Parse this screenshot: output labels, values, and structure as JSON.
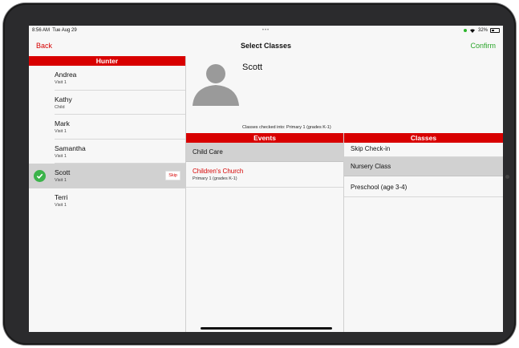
{
  "status": {
    "time": "8:56 AM",
    "date": "Tue Aug 29",
    "battery": "32%"
  },
  "nav": {
    "back": "Back",
    "title": "Select Classes",
    "confirm": "Confirm"
  },
  "family": {
    "header": "Hunter",
    "members": [
      {
        "name": "Andrea",
        "sub": "Visit 1"
      },
      {
        "name": "Kathy",
        "sub": "Child"
      },
      {
        "name": "Mark",
        "sub": "Visit 1"
      },
      {
        "name": "Samantha",
        "sub": "Visit 1"
      },
      {
        "name": "Scott",
        "sub": "Visit 1",
        "skip": "Skip"
      },
      {
        "name": "Terri",
        "sub": "Visit 1"
      }
    ]
  },
  "profile": {
    "name": "Scott",
    "checked_into": "Classes checked into: Primary 1 (grades K-1)"
  },
  "events": {
    "header": "Events",
    "items": [
      {
        "name": "Child Care",
        "sub": ""
      },
      {
        "name": "Children's Church",
        "sub": "Primary 1 (grades K-1)"
      }
    ]
  },
  "classes": {
    "header": "Classes",
    "items": [
      {
        "name": "Skip Check-in"
      },
      {
        "name": "Nursery Class"
      },
      {
        "name": "Preschool (age 3-4)"
      }
    ]
  },
  "colors": {
    "accent": "#d80000",
    "confirm": "#2aa52a",
    "selected_bg": "#d1d1d1",
    "check": "#3bb34a"
  }
}
